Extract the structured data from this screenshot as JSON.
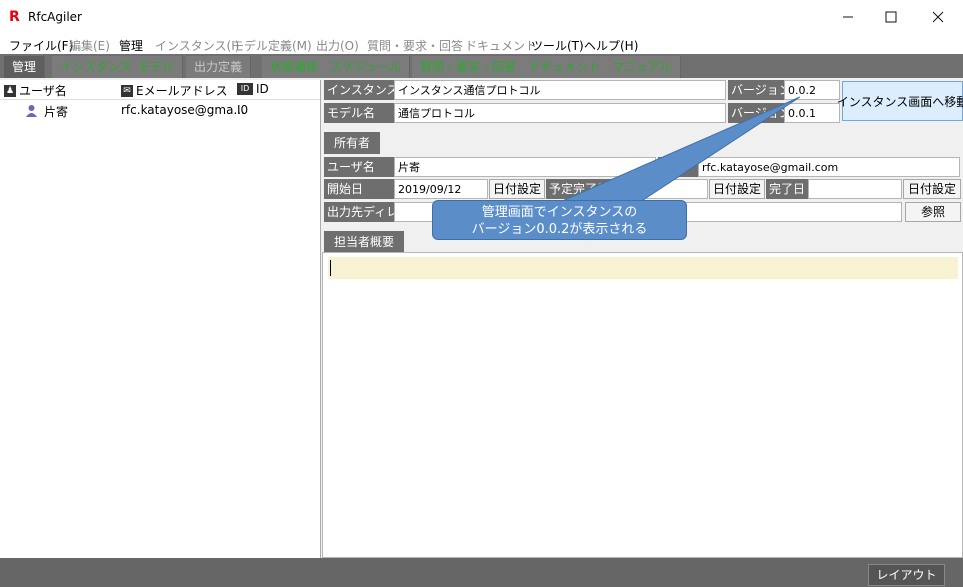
{
  "window": {
    "title": "RfcAgiler",
    "logo_glyph": "R",
    "controls": [
      "minimize-icon",
      "maximize-icon",
      "close-icon"
    ]
  },
  "menu": [
    {
      "label": "ファイル(F)",
      "enabled": true
    },
    {
      "label": "編集(E)",
      "enabled": false
    },
    {
      "label": "管理",
      "enabled": true
    },
    {
      "label": "インスタンス(I)",
      "enabled": false
    },
    {
      "label": "モデル定義(M)",
      "enabled": false
    },
    {
      "label": "出力(O)",
      "enabled": false
    },
    {
      "label": "質問・要求・回答",
      "enabled": false
    },
    {
      "label": "ドキュメント",
      "enabled": false
    },
    {
      "label": "ツール(T)",
      "enabled": true
    },
    {
      "label": "ヘルプ(H)",
      "enabled": true
    }
  ],
  "tabs": [
    {
      "label": "管理",
      "state": "active"
    },
    {
      "label": "インスタンス",
      "state": "green"
    },
    {
      "label": "モデル",
      "state": "green"
    },
    {
      "label": "出力定義",
      "state": "gray"
    },
    {
      "label": "状態遷移",
      "state": "green"
    },
    {
      "label": "スケジュール",
      "state": "green"
    },
    {
      "label": "質問・要求・回答",
      "state": "green"
    },
    {
      "label": "ドキュメント",
      "state": "green"
    },
    {
      "label": "マニュアル",
      "state": "green"
    }
  ],
  "users_panel": {
    "columns": {
      "username": "ユーザ名",
      "email": "Eメールアドレス",
      "id": "ID"
    },
    "rows": [
      {
        "username": "片寄",
        "email": "rfc.katayose@gma...",
        "id": "I0"
      }
    ]
  },
  "instance": {
    "instance_name_label": "インスタンス名",
    "instance_name": "インスタンス通信プロトコル",
    "model_name_label": "モデル名",
    "model_name": "通信プロトコル",
    "version_label": "バージョン",
    "instance_version": "0.0.2",
    "model_version": "0.0.1",
    "move_button": "インスタンス画面へ移動"
  },
  "owner": {
    "section_tab": "所有者",
    "username_label": "ユーザ名",
    "username": "片寄",
    "email_label_partial": "ル",
    "email": "rfc.katayose@gmail.com",
    "start_label": "開始日",
    "start_date": "2019/09/12",
    "set_date_label": "日付設定",
    "planned_label": "予定完了日",
    "planned_date": "",
    "done_label": "完了日",
    "done_date": "",
    "output_dir_label": "出力先ディレ",
    "output_dir": "",
    "browse_button": "参照"
  },
  "memo": {
    "section_tab": "担当者概要",
    "text": ""
  },
  "callout": {
    "line1": "管理画面でインスタンスの",
    "line2": "バージョン0.0.2が表示される"
  },
  "status": {
    "layout_button": "レイアウト"
  },
  "colors": {
    "tab_green": "#2ea82e",
    "callout_blue": "#5b8ec9",
    "label_gray": "#6e6e6e",
    "logo_red": "#e60012"
  }
}
